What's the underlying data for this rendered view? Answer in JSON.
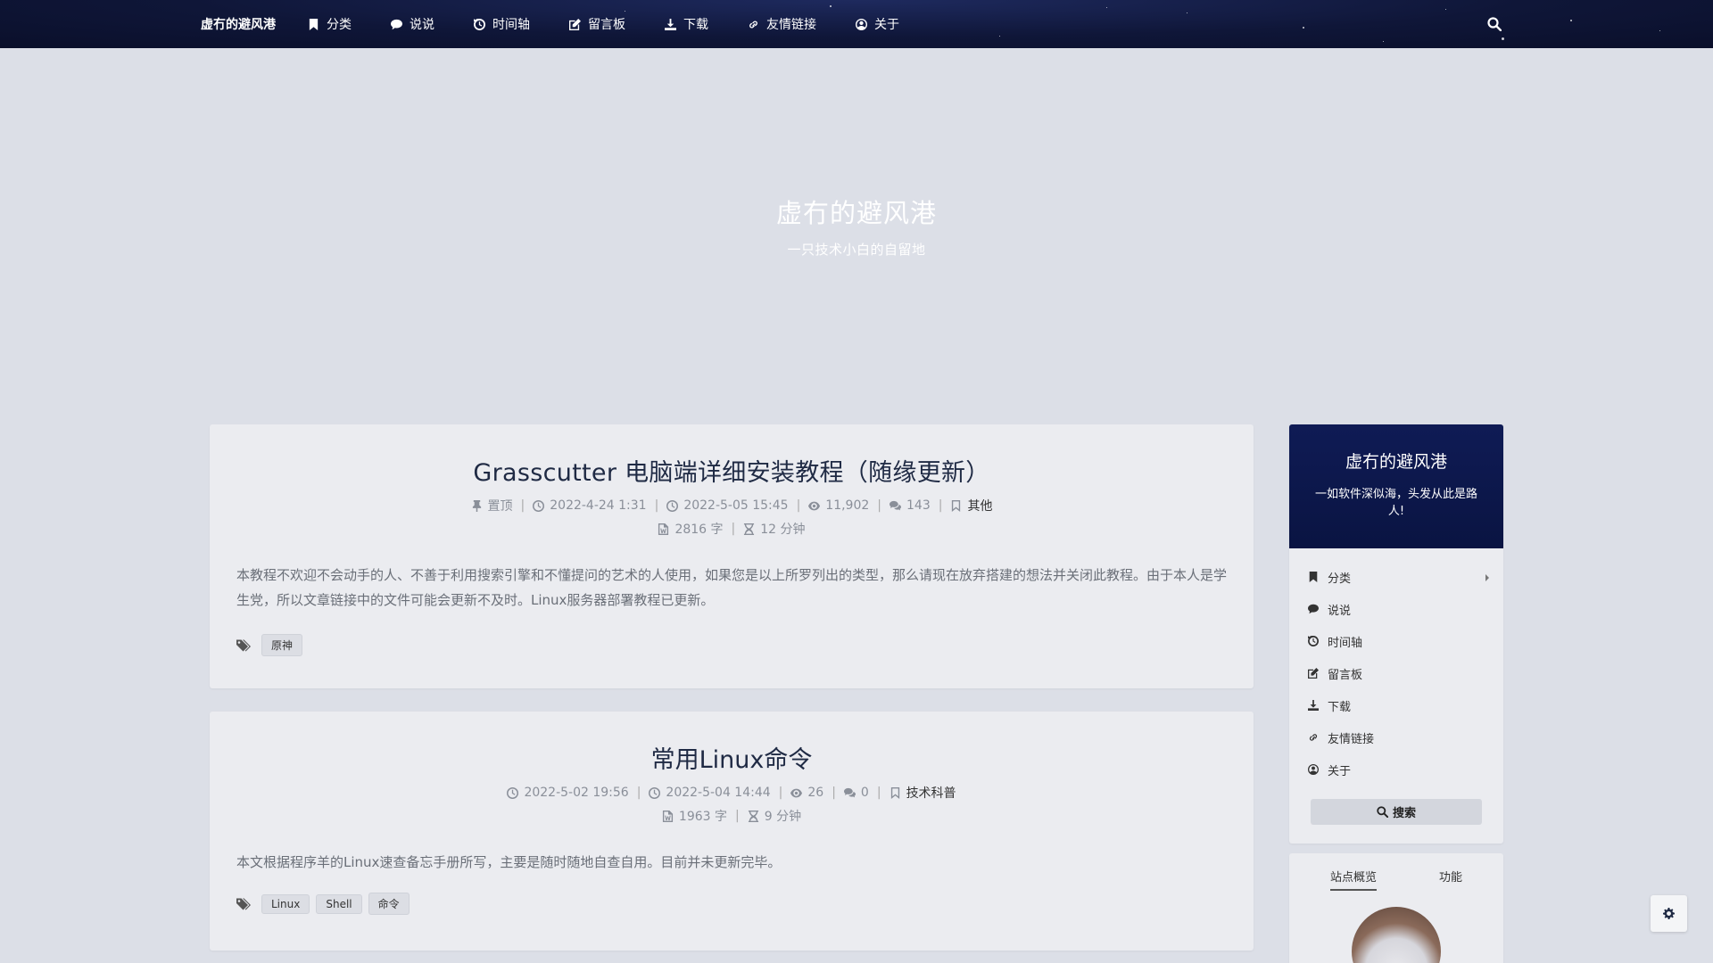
{
  "nav": {
    "brand": "虚冇的避风港",
    "items": [
      {
        "label": "分类",
        "icon": "bookmark-icon"
      },
      {
        "label": "说说",
        "icon": "comment-icon"
      },
      {
        "label": "时间轴",
        "icon": "history-icon"
      },
      {
        "label": "留言板",
        "icon": "edit-icon"
      },
      {
        "label": "下载",
        "icon": "download-icon"
      },
      {
        "label": "友情链接",
        "icon": "link-icon"
      },
      {
        "label": "关于",
        "icon": "user-circle-icon"
      }
    ]
  },
  "hero": {
    "title": "虚冇的避风港",
    "subtitle": "一只技术小白的自留地"
  },
  "posts": [
    {
      "title": "Grasscutter 电脑端详细安装教程（随缘更新）",
      "pinned": "置顶",
      "published": "2022-4-24 1:31",
      "updated": "2022-5-05 15:45",
      "views": "11,902",
      "comments": "143",
      "category": "其他",
      "words": "2816 字",
      "read_time": "12 分钟",
      "excerpt": "本教程不欢迎不会动手的人、不善于利用搜索引擎和不懂提问的艺术的人使用，如果您是以上所罗列出的类型，那么请现在放弃搭建的想法并关闭此教程。由于本人是学生党，所以文章链接中的文件可能会更新不及时。Linux服务器部署教程已更新。",
      "tags": [
        "原神"
      ]
    },
    {
      "title": "常用Linux命令",
      "published": "2022-5-02 19:56",
      "updated": "2022-5-04 14:44",
      "views": "26",
      "comments": "0",
      "category": "技术科普",
      "words": "1963 字",
      "read_time": "9 分钟",
      "excerpt": "本文根据程序羊的Linux速查备忘手册所写，主要是随时随地自查自用。目前并未更新完毕。",
      "tags": [
        "Linux",
        "Shell",
        "命令"
      ]
    }
  ],
  "sidebar": {
    "title": "虚冇的避风港",
    "motto": "一如软件深似海，头发从此是路人!",
    "items": [
      {
        "label": "分类",
        "icon": "bookmark-icon"
      },
      {
        "label": "说说",
        "icon": "comment-icon"
      },
      {
        "label": "时间轴",
        "icon": "history-icon"
      },
      {
        "label": "留言板",
        "icon": "edit-icon"
      },
      {
        "label": "下载",
        "icon": "download-icon"
      },
      {
        "label": "友情链接",
        "icon": "link-icon"
      },
      {
        "label": "关于",
        "icon": "user-circle-icon"
      }
    ],
    "search_label": "搜索",
    "tabs": [
      "站点概览",
      "功能"
    ]
  },
  "colors": {
    "nav_bg": "#0f1638",
    "page_bg": "#dcdfe7",
    "card_bg": "#ebecf0",
    "sidebar_head_bg": "#0f1b55",
    "title_color": "#1f2a44"
  }
}
